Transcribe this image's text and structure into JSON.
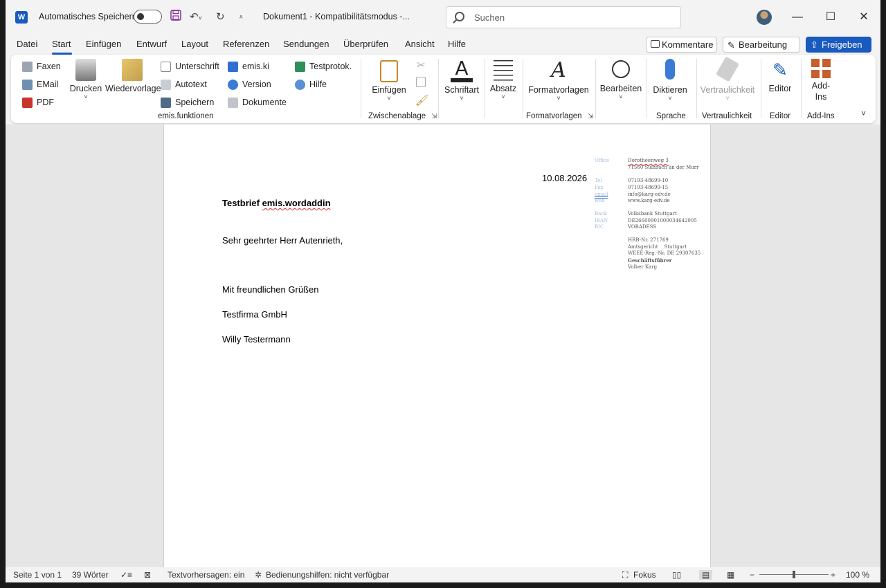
{
  "titlebar": {
    "app_icon_letter": "W",
    "autosave_label": "Automatisches Speichern",
    "doc_title": "Dokument1  -  Kompatibilitätsmodus  -...",
    "search_placeholder": "Suchen",
    "minimize": "—",
    "maximize": "☐",
    "close": "✕"
  },
  "menu": {
    "tabs": [
      "Datei",
      "Start",
      "Einfügen",
      "Entwurf",
      "Layout",
      "Referenzen",
      "Sendungen",
      "Überprüfen",
      "Ansicht",
      "Hilfe"
    ],
    "comments_label": "Kommentare",
    "editing_label": "Bearbeitung",
    "share_label": "Freigeben"
  },
  "ribbon": {
    "fax": "Faxen",
    "email": "EMail",
    "pdf": "PDF",
    "print": "Drucken",
    "template": "Wiedervorlage",
    "signature": "Unterschrift",
    "autotext": "Autotext",
    "save": "Speichern",
    "emis_ki": "emis.ki",
    "version": "Version",
    "documents": "Dokumente",
    "testprotocol": "Testprotok.",
    "help": "Hilfe",
    "group_emis": "emis.funktionen",
    "paste": "Einfügen",
    "group_clipboard": "Zwischenablage",
    "font": "Schriftart",
    "paragraph": "Absatz",
    "styles": "Formatvorlagen",
    "group_styles": "Formatvorlagen",
    "editing": "Bearbeiten",
    "dictate": "Diktieren",
    "group_voice": "Sprache",
    "sensitivity": "Vertraulichkeit",
    "group_sensitivity": "Vertraulichkeit",
    "editor": "Editor",
    "group_editor": "Editor",
    "addins_line1": "Add-",
    "addins_line2": "Ins",
    "group_addins": "Add-Ins"
  },
  "document": {
    "date": "10.08.2026",
    "subject_prefix": "Testbrief ",
    "subject_word": "emis.wordaddin",
    "salutation": "Sehr geehrter Herr Autenrieth,",
    "closing": "Mit freundlichen Grüßen",
    "company": "Testfirma GmbH",
    "signer": "Willy Testermann",
    "sidebar": {
      "office_label": "Office",
      "street": "Dorotheenweg 3",
      "city": "71560 Sulzbach an der Murr",
      "tel_label": "Tel",
      "tel": "07193-48699-10",
      "fax_label": "Fax",
      "fax": "07193-48699-15",
      "email_label": "email",
      "email": "info@karg-edv.de",
      "web_label": "web",
      "web": "www.karg-edv.de",
      "bank_label": "Bank",
      "bank": "Volksbank Stuttgart",
      "iban_label": "IBAN",
      "iban": "DE26600901000034642005",
      "bic_label": "BIC",
      "bic": "VOBADESS",
      "hrb": "HRB-Nr. 271769",
      "court": "Amtsgericht    Stuttgart",
      "weee": "WEEE-Reg.-Nr. DE 29307635",
      "ceo_label": "Geschäftsführer",
      "ceo": "Volker Karg"
    }
  },
  "status": {
    "page": "Seite 1 von 1",
    "words": "39 Wörter",
    "predictions": "Textvorhersagen: ein",
    "accessibility": "Bedienungshilfen: nicht verfügbar",
    "focus": "Fokus",
    "zoom": "100 %"
  },
  "colors": {
    "accent": "#185abd",
    "squiggle": "#d13438"
  }
}
